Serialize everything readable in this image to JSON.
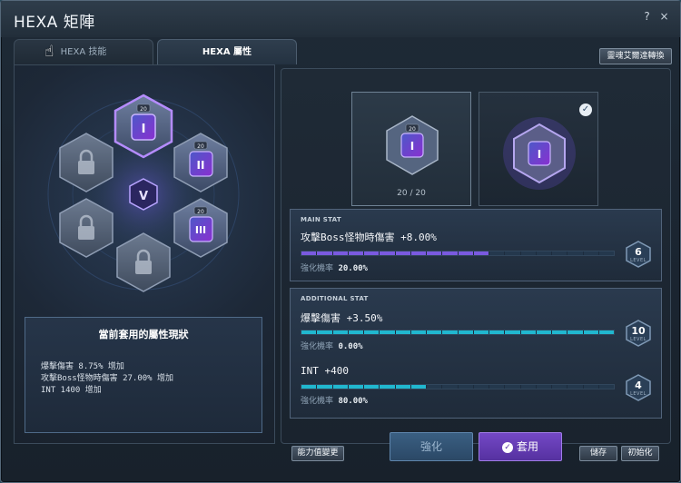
{
  "window": {
    "title": "HEXA 矩陣",
    "help_icon": "?",
    "close_icon": "×"
  },
  "tabs": [
    {
      "label": "HEXA 技能",
      "active": false
    },
    {
      "label": "HEXA 屬性",
      "active": true
    }
  ],
  "top_right_button": "靈魂艾爾達轉換",
  "hex_grid": {
    "nodes": [
      {
        "id": "top",
        "level": "20",
        "numeral": "I",
        "locked": false,
        "selected": true
      },
      {
        "id": "upper-right",
        "level": "20",
        "numeral": "II",
        "locked": false,
        "selected": false
      },
      {
        "id": "lower-right",
        "level": "20",
        "numeral": "III",
        "locked": false,
        "selected": false
      },
      {
        "id": "bottom",
        "locked": true
      },
      {
        "id": "lower-left",
        "locked": true
      },
      {
        "id": "upper-left",
        "locked": true
      }
    ],
    "center_emblem": "V"
  },
  "status": {
    "title": "當前套用的屬性現狀",
    "lines": [
      "爆擊傷害 8.75% 增加",
      "攻擊Boss怪物時傷害 27.00% 增加",
      "INT 1400 增加"
    ]
  },
  "cards": [
    {
      "level_text": "20 / 20",
      "numeral": "I",
      "selected": false
    },
    {
      "numeral": "I",
      "selected": true
    }
  ],
  "main_stat": {
    "header": "MAIN STAT",
    "name": "攻擊Boss怪物時傷害 +8.00%",
    "rate_label": "強化機率",
    "rate_value": "20.00%",
    "level": "6",
    "level_label": "LEVEL",
    "progress": 0.6
  },
  "additional_stat": {
    "header": "ADDITIONAL STAT",
    "items": [
      {
        "name": "爆擊傷害 +3.50%",
        "rate_label": "強化機率",
        "rate_value": "0.00%",
        "level": "10",
        "level_label": "LEVEL",
        "progress": 1.0
      },
      {
        "name": "INT +400",
        "rate_label": "強化機率",
        "rate_value": "80.00%",
        "level": "4",
        "level_label": "LEVEL",
        "progress": 0.4
      }
    ]
  },
  "buttons": {
    "change_stat": "能力值變更",
    "enhance": "強化",
    "apply": "套用",
    "save": "儲存",
    "reset": "初始化"
  },
  "colors": {
    "main_bar": "#7a5ae0",
    "add_bar": "#21b7cf",
    "apply_button": "#6a3fc0",
    "enhance_button": "#355878"
  }
}
